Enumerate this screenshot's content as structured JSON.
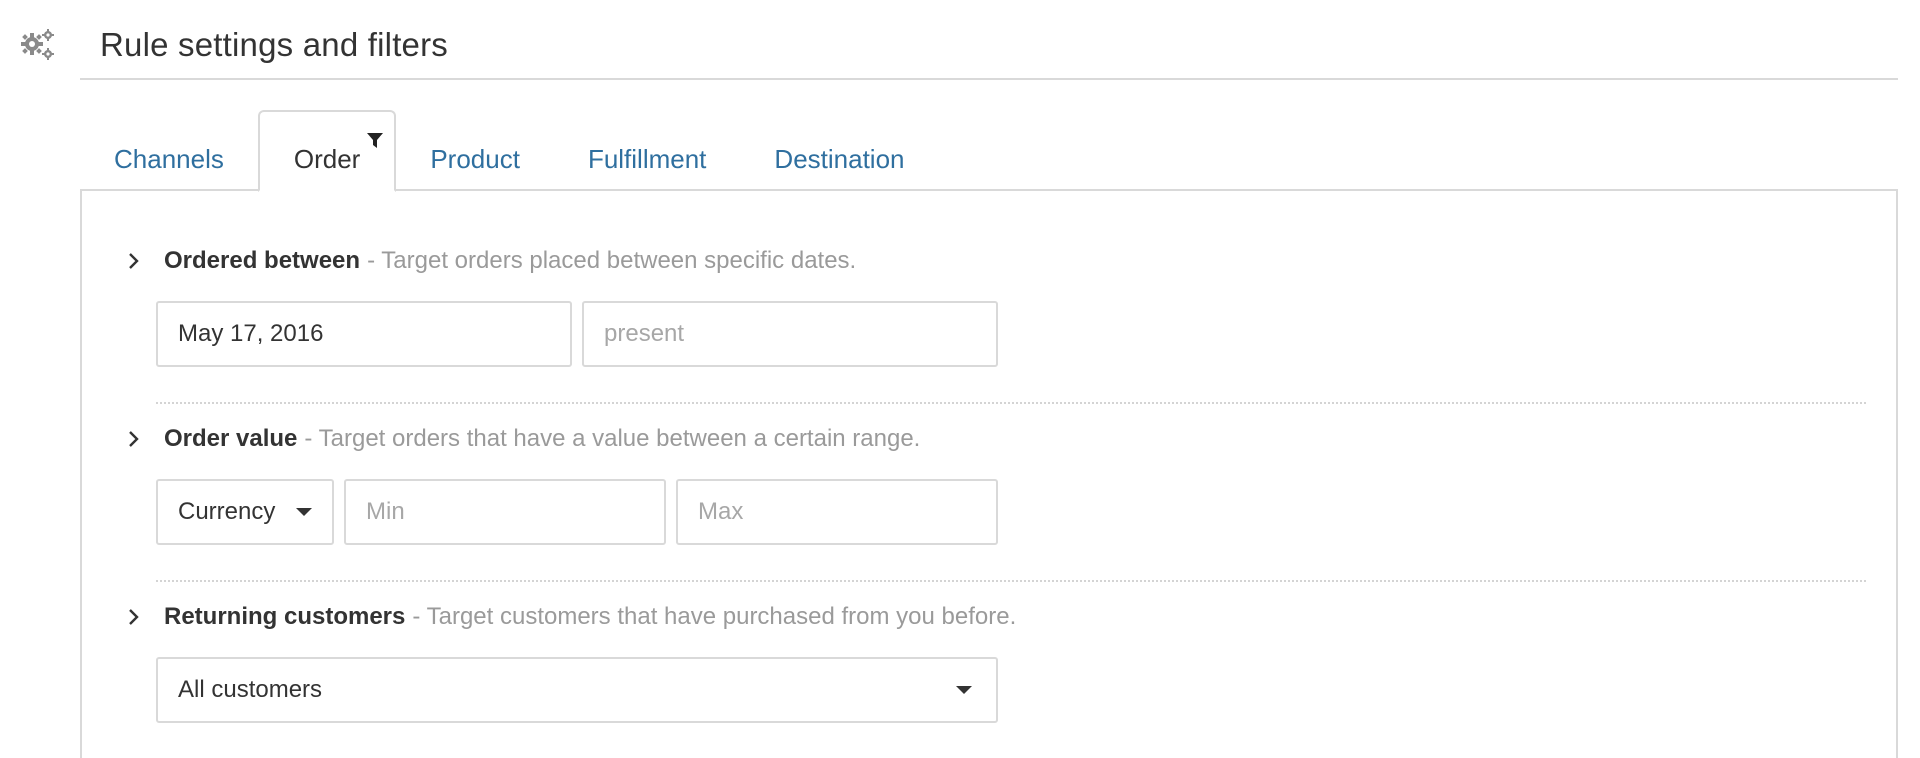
{
  "header": {
    "title": "Rule settings and filters",
    "icon": "gears-icon"
  },
  "tabs": [
    {
      "label": "Channels",
      "active": false
    },
    {
      "label": "Order",
      "active": true,
      "icon": "filter-icon"
    },
    {
      "label": "Product",
      "active": false
    },
    {
      "label": "Fulfillment",
      "active": false
    },
    {
      "label": "Destination",
      "active": false
    }
  ],
  "sections": {
    "ordered_between": {
      "title": "Ordered between",
      "description": "- Target orders placed between specific dates.",
      "start_value": "May 17, 2016",
      "end_placeholder": "present"
    },
    "order_value": {
      "title": "Order value",
      "description": "- Target orders that have a value between a certain range.",
      "currency_label": "Currency",
      "min_placeholder": "Min",
      "max_placeholder": "Max"
    },
    "returning_customers": {
      "title": "Returning customers",
      "description": "- Target customers that have purchased from you before.",
      "selected": "All customers"
    }
  },
  "colors": {
    "link": "#2f6f9f",
    "text": "#333333",
    "muted": "#9a9a9a",
    "border": "#d9d9d9"
  }
}
